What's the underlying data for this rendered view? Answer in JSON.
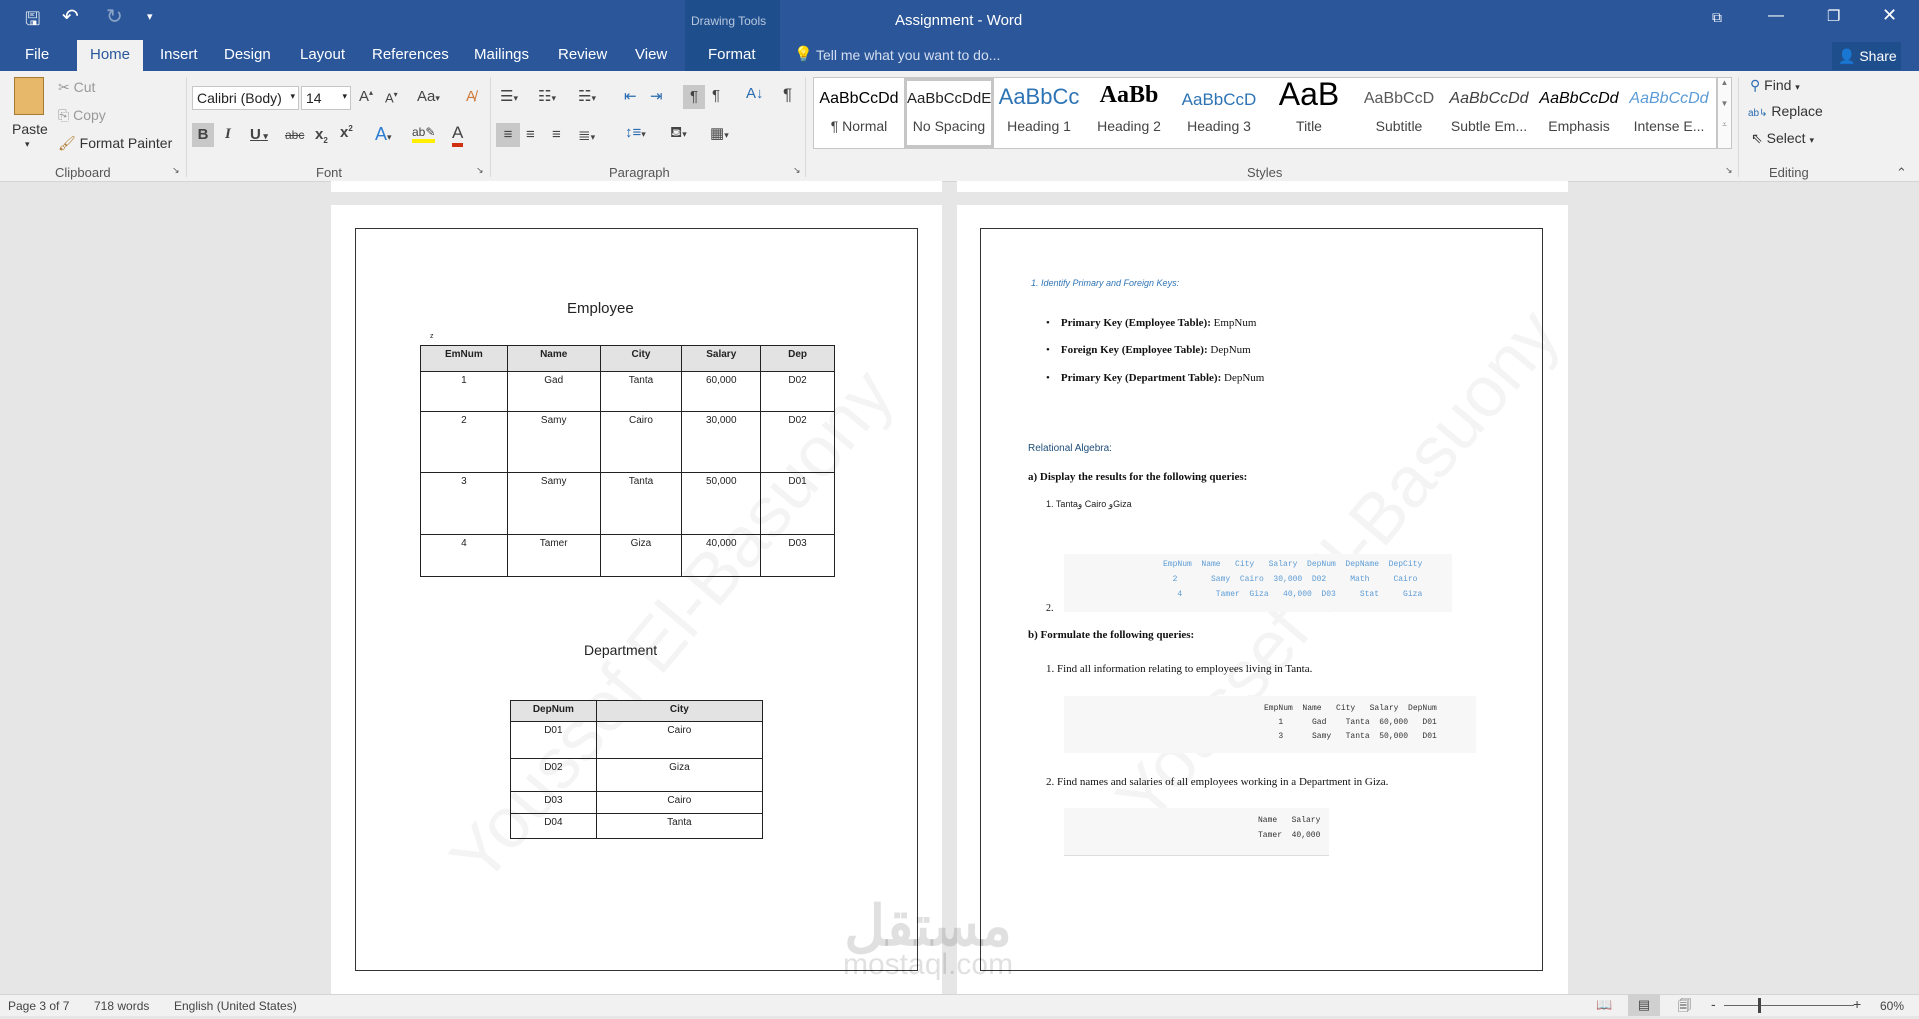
{
  "titlebar": {
    "title": "Assignment - Word",
    "context_group": "Drawing Tools",
    "share": "Share",
    "tell_me": "Tell me what you want to do..."
  },
  "tabs": [
    "File",
    "Home",
    "Insert",
    "Design",
    "Layout",
    "References",
    "Mailings",
    "Review",
    "View",
    "Format"
  ],
  "clipboard": {
    "paste": "Paste",
    "cut": "Cut",
    "copy": "Copy",
    "format_painter": "Format Painter",
    "label": "Clipboard"
  },
  "font": {
    "name": "Calibri (Body)",
    "size": "14",
    "change_case": "Aa",
    "label": "Font"
  },
  "paragraph": {
    "label": "Paragraph"
  },
  "styles": {
    "label": "Styles",
    "items": [
      {
        "preview": "AaBbCcDd",
        "name": "¶ Normal"
      },
      {
        "preview": "AaBbCcDdE",
        "name": "No Spacing"
      },
      {
        "preview": "AaBbCc",
        "name": "Heading 1"
      },
      {
        "preview": "AaBb",
        "name": "Heading 2"
      },
      {
        "preview": "AaBbCcD",
        "name": "Heading 3"
      },
      {
        "preview": "AaB",
        "name": "Title"
      },
      {
        "preview": "AaBbCcD",
        "name": "Subtitle"
      },
      {
        "preview": "AaBbCcDd",
        "name": "Subtle Em..."
      },
      {
        "preview": "AaBbCcDd",
        "name": "Emphasis"
      },
      {
        "preview": "AaBbCcDd",
        "name": "Intense E..."
      }
    ]
  },
  "editing": {
    "find": "Find",
    "replace": "Replace",
    "select": "Select",
    "label": "Editing"
  },
  "left_page": {
    "employee_title": "Employee",
    "stray": "z",
    "employee_headers": [
      "EmNum",
      "Name",
      "City",
      "Salary",
      "Dep"
    ],
    "employee_rows": [
      [
        "1",
        "Gad",
        "Tanta",
        "60,000",
        "D02"
      ],
      [
        "2",
        "Samy",
        "Cairo",
        "30,000",
        "D02"
      ],
      [
        "3",
        "Samy",
        "Tanta",
        "50,000",
        "D01"
      ],
      [
        "4",
        "Tamer",
        "Giza",
        "40,000",
        "D03"
      ]
    ],
    "department_title": "Department",
    "department_headers": [
      "DepNum",
      "City"
    ],
    "department_rows": [
      [
        "D01",
        "Cairo"
      ],
      [
        "D02",
        "Giza"
      ],
      [
        "D03",
        "Cairo"
      ],
      [
        "D04",
        "Tanta"
      ]
    ]
  },
  "right_page": {
    "heading": "1. Identify Primary and Foreign Keys:",
    "bullets": [
      {
        "b": "Primary Key (Employee Table):",
        "t": " EmpNum"
      },
      {
        "b": "Foreign Key (Employee Table):",
        "t": " DepNum"
      },
      {
        "b": "Primary Key (Department Table):",
        "t": " DepNum"
      }
    ],
    "relational": "Relational Algebra:",
    "a_heading": "a) Display the results for the following queries:",
    "a1": "1.   Tantaو Cairo وGiza",
    "a2": "2.",
    "code1": [
      "EmpNum  Name   City   Salary  DepNum  DepName  DepCity",
      "  2       Samy  Cairo  30,000  D02     Math     Cairo",
      "   4       Tamer  Giza   40,000  D03     Stat     Giza"
    ],
    "b_heading": "b) Formulate the following queries:",
    "b1": "1.   Find all information relating to employees living in Tanta.",
    "code2": [
      "EmpNum  Name   City   Salary  DepNum",
      "   1      Gad    Tanta  60,000   D01",
      "   3      Samy   Tanta  50,000   D01"
    ],
    "b2": "2.   Find names and salaries of all employees working in a Department in Giza.",
    "code3": [
      "Name   Salary",
      "Tamer  40,000"
    ]
  },
  "watermark": "Youssef El-Basuony",
  "logo_watermark": {
    "arabic": "مستقل",
    "latin": "mostaql.com"
  },
  "status": {
    "page": "Page 3 of 7",
    "words": "718 words",
    "language": "English (United States)",
    "zoom": "60%"
  }
}
